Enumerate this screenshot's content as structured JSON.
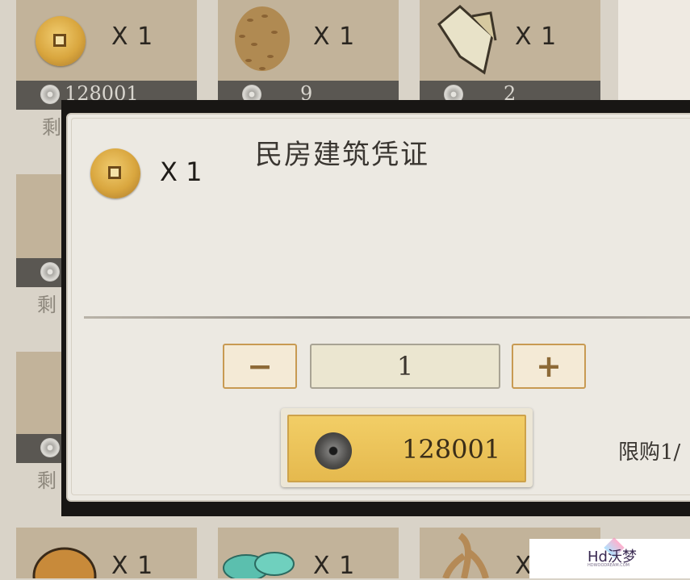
{
  "shop_grid": {
    "top_row": [
      {
        "qty": "X 1",
        "price": "128001",
        "icon": "copper-coin-icon"
      },
      {
        "qty": "X 1",
        "price": "9",
        "icon": "grain-pile-icon"
      },
      {
        "qty": "X 1",
        "price": "2",
        "icon": "wood-log-icon"
      }
    ],
    "bottom_row": [
      {
        "qty": "X 1",
        "icon": "pumpkin-icon"
      },
      {
        "qty": "X 1",
        "icon": "jade-stones-icon"
      },
      {
        "qty": "X",
        "icon": "ginseng-icon"
      }
    ],
    "remaining_label": "剩"
  },
  "dialog": {
    "title": "民房建筑凭证",
    "item_qty": "X 1",
    "quantity_value": "1",
    "decrease_label": "−",
    "increase_label": "+",
    "buy_price": "128001",
    "purchase_limit": "限购1/"
  },
  "watermark": {
    "text": "Hd沃梦",
    "subtext": "HDWOODREAM.COM"
  }
}
